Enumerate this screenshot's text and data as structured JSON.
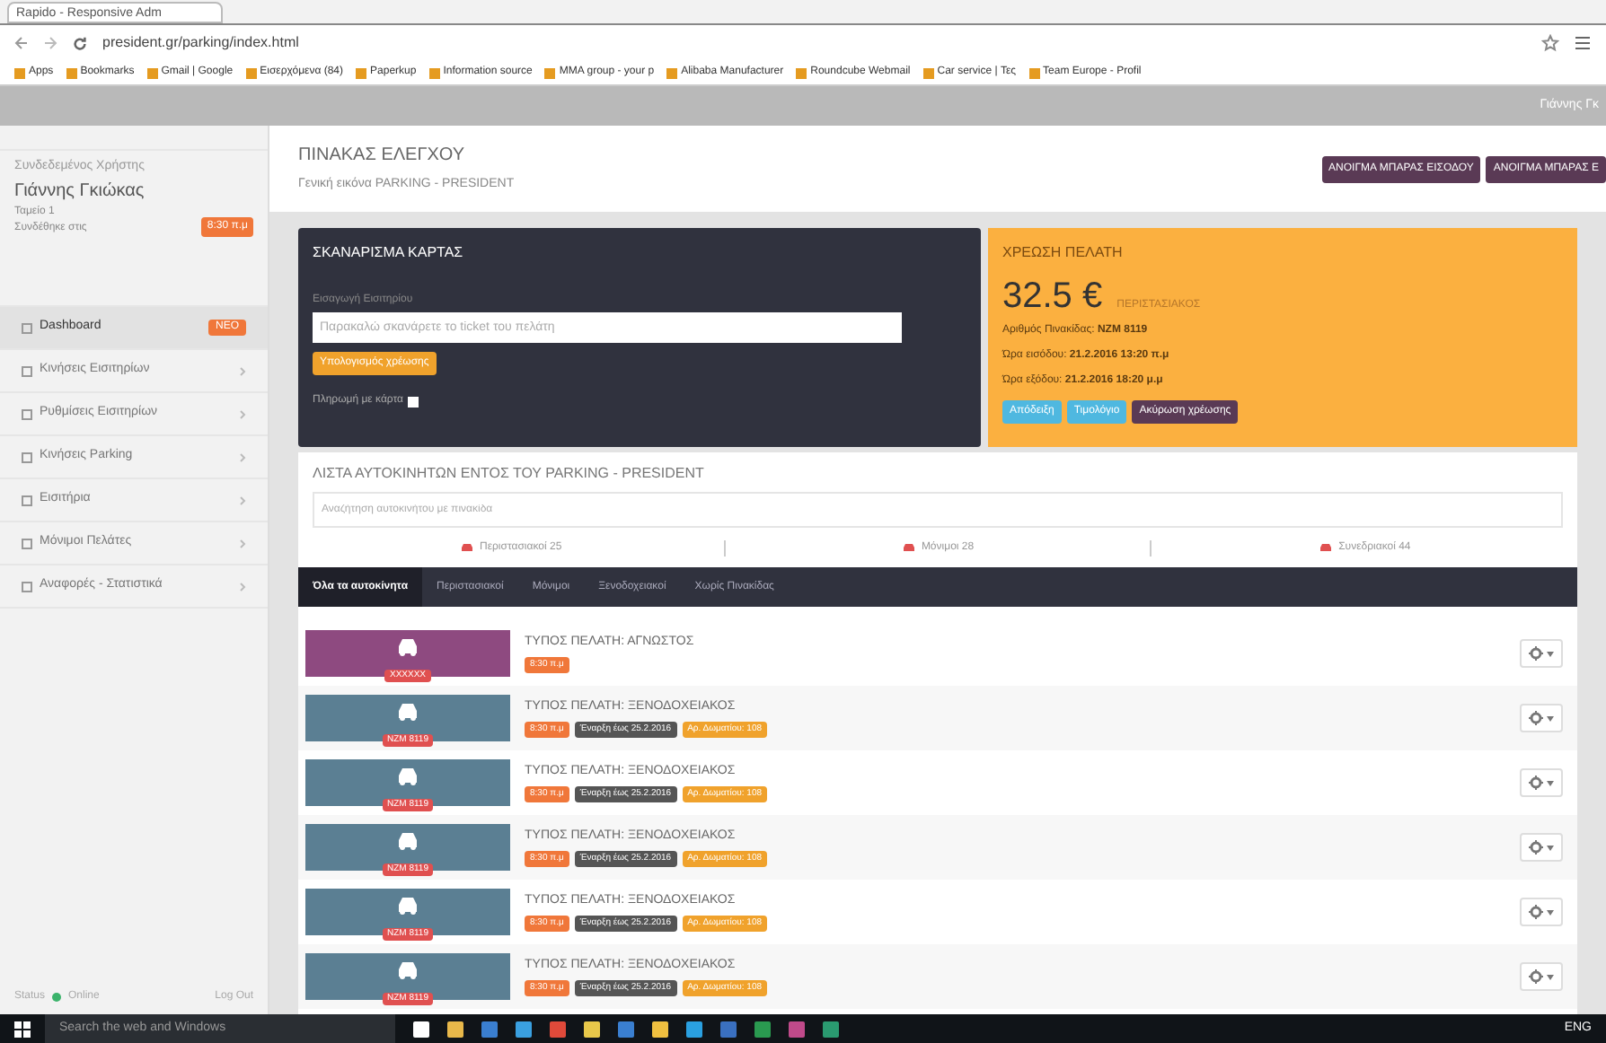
{
  "browser": {
    "tab_title": "Rapido - Responsive Adm",
    "url": "president.gr/parking/index.html",
    "bookmarks": [
      "Apps",
      "Bookmarks",
      "Gmail | Google",
      "Εισερχόμενα (84)",
      "Paperkup",
      "Information source",
      "MMA group - your p",
      "Alibaba Manufacturer",
      "Roundcube Webmail",
      "Car service | Τες",
      "Team Europe - Profil"
    ],
    "top_bar_user": "Γιάννης Γκ"
  },
  "sidebar": {
    "label": "Συνδεδεμένος Χρήστης",
    "user_name": "Γιάννης Γκιώκας",
    "role": "Ταμείο 1",
    "login_label": "Συνδέθηκε στις",
    "login_time": "8:30 π.μ",
    "items": [
      {
        "label": "Dashboard",
        "selected": true,
        "badge": "ΝΕΟ"
      },
      {
        "label": "Κινήσεις Εισιτηρίων",
        "selected": false
      },
      {
        "label": "Ρυθμίσεις Εισιτηρίων",
        "selected": false
      },
      {
        "label": "Κινήσεις Parking",
        "selected": false
      },
      {
        "label": "Εισιτήρια",
        "selected": false
      },
      {
        "label": "Μόνιμοι Πελάτες",
        "selected": false
      },
      {
        "label": "Αναφορές - Στατιστικά",
        "selected": false
      }
    ],
    "status_label": "Status",
    "status": "Online",
    "logout": "Log Out"
  },
  "header": {
    "title": "ΠΙΝΑΚΑΣ ΕΛΕΓΧΟΥ",
    "subtitle": "Γενική εικόνα PARKING - PRESIDENT",
    "buttons": [
      "ΑΝΟΙΓΜΑ ΜΠΑΡΑΣ ΕΙΣΟΔΟΥ",
      "ΑΝΟΙΓΜΑ ΜΠΑΡΑΣ Ε"
    ]
  },
  "scan_card": {
    "title": "ΣΚΑΝΑΡΙΣΜΑ ΚΑΡΤΑΣ",
    "field_label": "Εισαγωγή Εισιτηρίου",
    "placeholder": "Παρακαλώ σκανάρετε το ticket του πελάτη",
    "button": "Υπολογισμός χρέωσης",
    "checkbox_label": "Πληρωμή με κάρτα",
    "checked": false
  },
  "charge_card": {
    "title": "ΧΡΕΩΣΗ ΠΕΛΑΤΗ",
    "amount": "32.5 €",
    "customer_type": "ΠΕΡΙΣΤΑΣΙΑΚΟΣ",
    "details": [
      {
        "label": "Αριθμός Πινακίδας:",
        "value": "NZM 8119"
      },
      {
        "label": "Ώρα εισόδου:",
        "value": "21.2.2016 13:20 π.μ"
      },
      {
        "label": "Ώρα εξόδου:",
        "value": "21.2.2016 18:20 μ.μ"
      }
    ],
    "buttons": [
      {
        "label": "Απόδειξη",
        "kind": "info"
      },
      {
        "label": "Τιμολόγιο",
        "kind": "info"
      },
      {
        "label": "Ακύρωση χρέωσης",
        "kind": "danger"
      }
    ]
  },
  "car_list": {
    "title": "ΛΙΣΤΑ ΑΥΤΟΚΙΝΗΤΩΝ ΕΝΤΟΣ ΤΟΥ PARKING - PRESIDENT",
    "search_placeholder": "Αναζήτηση αυτοκινήτου με πινακίδα",
    "stats": [
      "Περιστασιακοί 25",
      "Μόνιμοι 28",
      "Συνεδριακοί 44"
    ],
    "tabs": [
      {
        "label": "Όλα τα αυτοκίνητα",
        "selected": true
      },
      {
        "label": "Περιστασιακοί",
        "selected": false
      },
      {
        "label": "Μόνιμοι",
        "selected": false
      },
      {
        "label": "Ξενοδοχειακοί",
        "selected": false
      },
      {
        "label": "Χωρίς Πινακίδας",
        "selected": false
      }
    ],
    "rows": [
      {
        "color": "#8e4a80",
        "plate": "ΧΧΧΧΧΧ",
        "customer_type": "ΤΥΠΟΣ ΠΕΛΑΤΗ: ΑΓΝΩΣΤΟΣ",
        "time": "8:30 π.μ"
      },
      {
        "color": "#5b7f93",
        "plate": "NZM 8119",
        "customer_type": "ΤΥΠΟΣ ΠΕΛΑΤΗ: ΞΕΝΟΔΟΧΕΙΑΚΟΣ",
        "time": "8:30 π.μ",
        "validity": "Έναρξη έως 25.2.2016",
        "room": "Αρ. Δωματίου: 108"
      },
      {
        "color": "#5b7f93",
        "plate": "NZM 8119",
        "customer_type": "ΤΥΠΟΣ ΠΕΛΑΤΗ: ΞΕΝΟΔΟΧΕΙΑΚΟΣ",
        "time": "8:30 π.μ",
        "validity": "Έναρξη έως 25.2.2016",
        "room": "Αρ. Δωματίου: 108"
      },
      {
        "color": "#5b7f93",
        "plate": "NZM 8119",
        "customer_type": "ΤΥΠΟΣ ΠΕΛΑΤΗ: ΞΕΝΟΔΟΧΕΙΑΚΟΣ",
        "time": "8:30 π.μ",
        "validity": "Έναρξη έως 25.2.2016",
        "room": "Αρ. Δωματίου: 108"
      },
      {
        "color": "#5b7f93",
        "plate": "NZM 8119",
        "customer_type": "ΤΥΠΟΣ ΠΕΛΑΤΗ: ΞΕΝΟΔΟΧΕΙΑΚΟΣ",
        "time": "8:30 π.μ",
        "validity": "Έναρξη έως 25.2.2016",
        "room": "Αρ. Δωματίου: 108"
      },
      {
        "color": "#5b7f93",
        "plate": "NZM 8119",
        "customer_type": "ΤΥΠΟΣ ΠΕΛΑΤΗ: ΞΕΝΟΔΟΧΕΙΑΚΟΣ",
        "time": "8:30 π.μ",
        "validity": "Έναρξη έως 25.2.2016",
        "room": "Αρ. Δωματίου: 108"
      }
    ]
  },
  "taskbar": {
    "search_placeholder": "Search the web and Windows",
    "language": "ENG"
  }
}
